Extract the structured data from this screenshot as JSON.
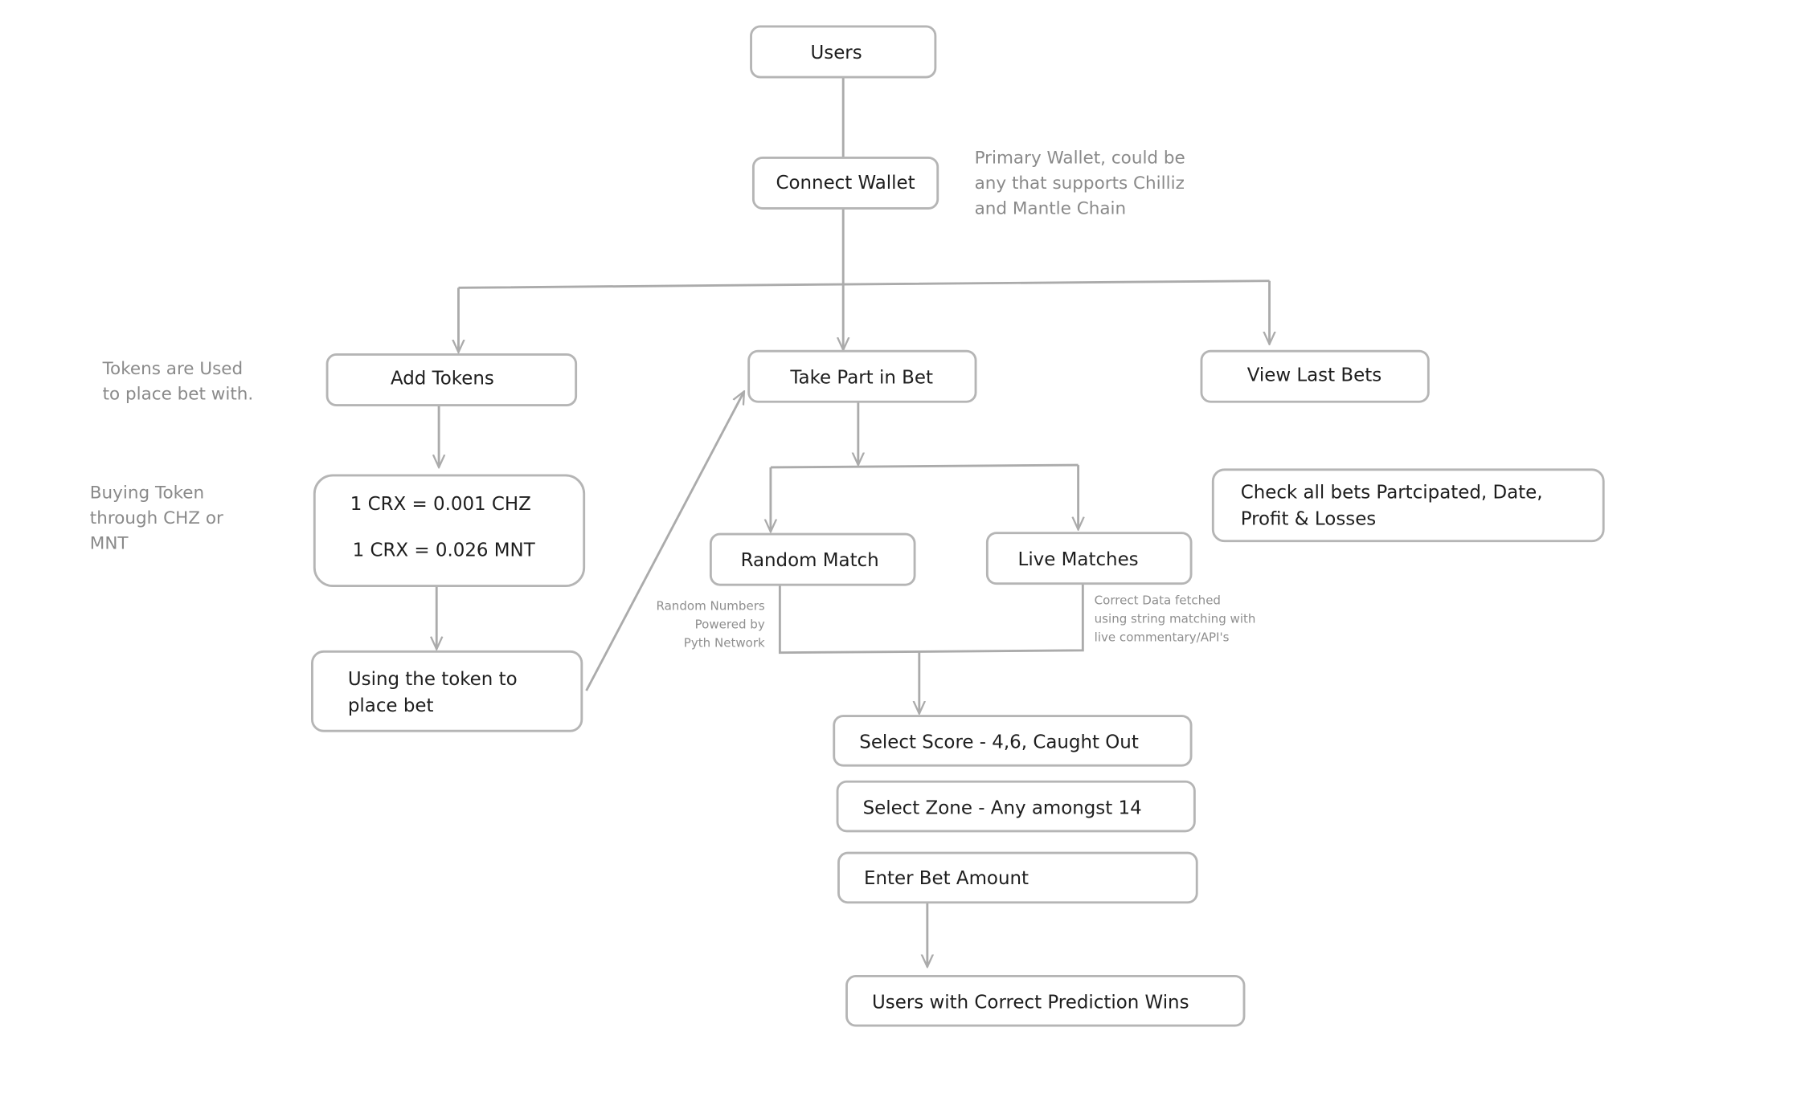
{
  "nodes": {
    "users": "Users",
    "connect_wallet": "Connect Wallet",
    "add_tokens": "Add Tokens",
    "take_part": "Take Part in Bet",
    "view_last_bets": "View Last Bets",
    "rates": [
      "1 CRX = 0.001 CHZ",
      "1 CRX = 0.026 MNT"
    ],
    "using_token": [
      "Using the token to",
      "place bet"
    ],
    "random_match": "Random Match",
    "live_matches": "Live Matches",
    "check_bets": [
      "Check all bets Partcipated, Date,",
      "Profit & Losses"
    ],
    "select_score": "Select Score - 4,6, Caught Out",
    "select_zone": "Select Zone - Any amongst 14",
    "enter_amount": "Enter Bet Amount",
    "winners": "Users with Correct Prediction Wins"
  },
  "notes": {
    "wallet": [
      "Primary Wallet, could be",
      "any that supports Chilliz",
      "and Mantle Chain"
    ],
    "tokens_used": [
      "Tokens are Used",
      "to place bet with."
    ],
    "buying": [
      "Buying Token",
      "through CHZ or",
      "MNT"
    ],
    "random_numbers": [
      "Random Numbers",
      "Powered by",
      "Pyth Network"
    ],
    "correct_data": [
      "Correct Data fetched",
      "using string matching with",
      "live commentary/API's"
    ]
  },
  "colors": {
    "stroke": "#b5b5b5",
    "text": "#1e1e1e",
    "note": "#8a8a8a"
  }
}
